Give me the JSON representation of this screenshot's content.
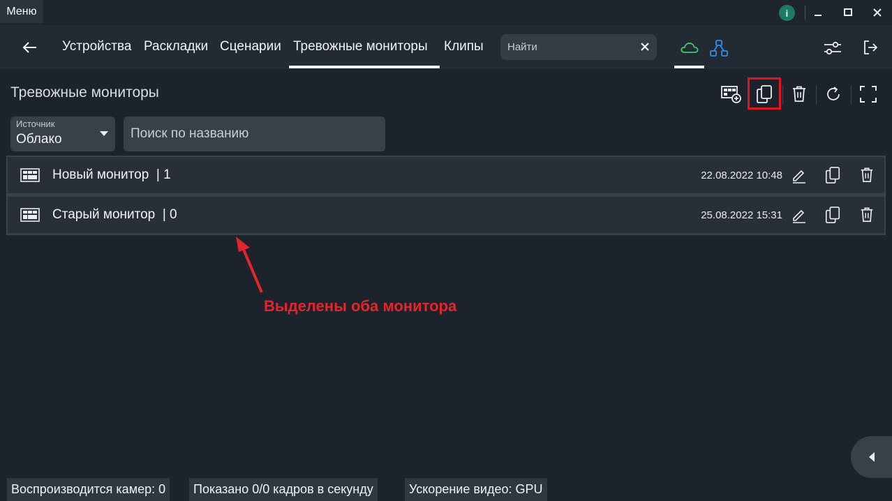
{
  "titlebar": {
    "menu_label": "Меню",
    "info_label": "i"
  },
  "nav": {
    "tabs": [
      "Устройства",
      "Раскладки",
      "Сценарии",
      "Тревожные мониторы",
      "Клипы"
    ],
    "active_tab": "Тревожные мониторы",
    "search_placeholder": "Найти"
  },
  "main": {
    "title": "Тревожные мониторы",
    "source": {
      "label": "Источник",
      "value": "Облако"
    },
    "name_search_placeholder": "Поиск по названию",
    "monitors": [
      {
        "name": "Новый монитор",
        "count": "| 1",
        "date": "22.08.2022 10:48"
      },
      {
        "name": "Старый монитор",
        "count": "| 0",
        "date": "25.08.2022 15:31"
      }
    ]
  },
  "annotation": {
    "text": "Выделены оба монитора",
    "color": "#e3262b"
  },
  "status_bar": {
    "cameras": "Воспроизводится камер: 0",
    "fps": "Показано 0/0 кадров в секунду",
    "accel": "Ускорение видео: GPU"
  },
  "colors": {
    "background": "#1c232d",
    "cloud_accent": "#3ecf6b",
    "network_accent": "#2e8fe6",
    "highlight": "#e3151c"
  },
  "icons": [
    "info-icon",
    "minimize-icon",
    "maximize-icon",
    "close-icon",
    "back-arrow-icon",
    "clear-icon",
    "cloud-icon",
    "network-icon",
    "sliders-icon",
    "logout-icon",
    "add-monitor-icon",
    "copy-icon",
    "trash-icon",
    "refresh-icon",
    "fullscreen-icon",
    "monitor-grid-icon",
    "edit-icon",
    "chevron-left-icon"
  ]
}
